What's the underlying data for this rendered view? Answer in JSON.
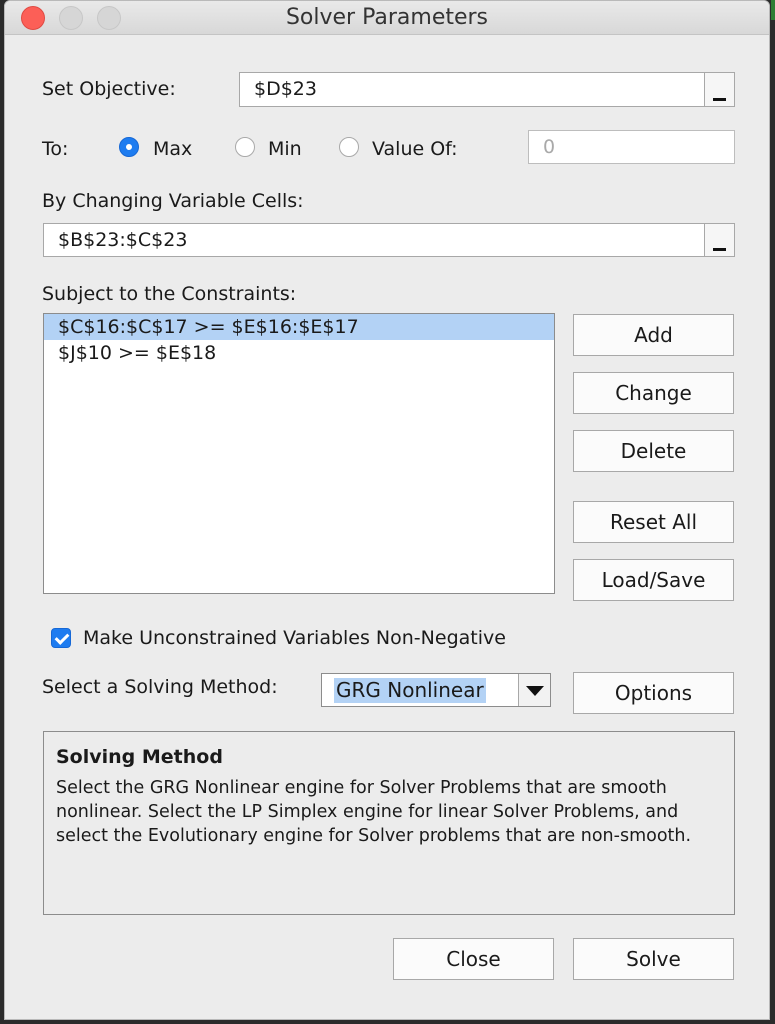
{
  "window": {
    "title": "Solver Parameters"
  },
  "objective": {
    "label": "Set Objective:",
    "value": "$D$23"
  },
  "to": {
    "label": "To:",
    "options": [
      {
        "label": "Max",
        "selected": true
      },
      {
        "label": "Min",
        "selected": false
      },
      {
        "label": "Value Of:",
        "selected": false
      }
    ],
    "value_of": "0"
  },
  "changing": {
    "label": "By Changing Variable Cells:",
    "value": "$B$23:$C$23"
  },
  "constraints": {
    "label": "Subject to the Constraints:",
    "items": [
      "$C$16:$C$17 >= $E$16:$E$17",
      "$J$10 >= $E$18"
    ],
    "selected_index": 0
  },
  "buttons": {
    "add": "Add",
    "change": "Change",
    "delete": "Delete",
    "reset_all": "Reset All",
    "load_save": "Load/Save",
    "options": "Options",
    "close": "Close",
    "solve": "Solve"
  },
  "nonneg": {
    "label": "Make Unconstrained Variables Non-Negative",
    "checked": true
  },
  "method": {
    "label": "Select a Solving Method:",
    "value": "GRG Nonlinear"
  },
  "info": {
    "heading": "Solving Method",
    "text": "Select the GRG Nonlinear engine for Solver Problems that are smooth nonlinear. Select the LP Simplex engine for linear Solver Problems, and select the Evolutionary engine for Solver problems that are non-smooth."
  },
  "colors": {
    "accent": "#1e7cf0",
    "selection": "#b3d2f5",
    "close_button": "#fc5f57"
  }
}
